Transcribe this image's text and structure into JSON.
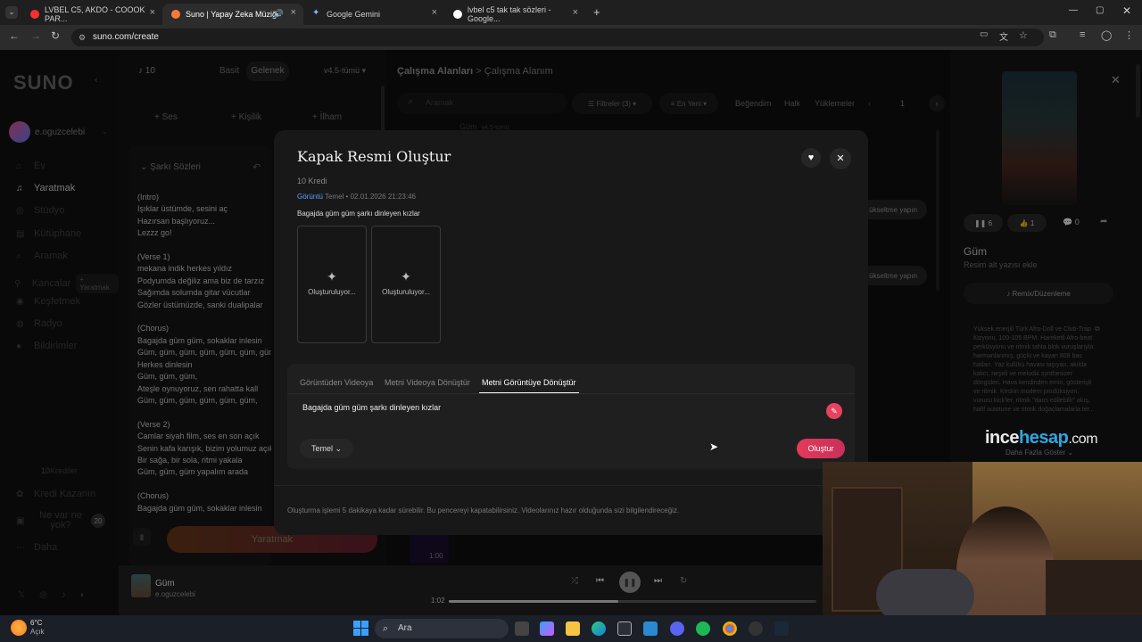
{
  "browser": {
    "tabs": [
      {
        "label": "LVBEL C5, AKDO - COOOK PAR...",
        "close": "×"
      },
      {
        "label": "Suno | Yapay Zeka Müziği",
        "close": "×"
      },
      {
        "label": "Google Gemini",
        "close": "×"
      },
      {
        "label": "lvbel c5 tak tak sözleri - Google...",
        "close": "×"
      }
    ],
    "new_tab": "+",
    "url": "suno.com/create"
  },
  "sidebar": {
    "logo": "SUNO",
    "user": "e.oguzcelebi",
    "items": [
      {
        "label": "Ev",
        "icon": "home-icon"
      },
      {
        "label": "Yaratmak",
        "icon": "music-icon"
      },
      {
        "label": "Stüdyo",
        "icon": "studio-icon"
      },
      {
        "label": "Kütüphane",
        "icon": "library-icon"
      },
      {
        "label": "Aramak",
        "icon": "search-icon"
      },
      {
        "label": "Kancalar",
        "icon": "hook-icon"
      },
      {
        "label": "Keşfetmek",
        "icon": "compass-icon"
      },
      {
        "label": "Radyo",
        "icon": "radio-icon"
      },
      {
        "label": "Bildirimler",
        "icon": "bell-icon"
      }
    ],
    "hooks_badge": "+ Yaratmak",
    "credits_num": "10",
    "credits_label": "Krediler",
    "earn": "Kredi Kazanın",
    "whats_new": "Ne var ne yok?",
    "whats_new_badge": "20",
    "more": "Daha"
  },
  "creator": {
    "credits": "10",
    "mode_simple": "Basit",
    "mode_custom": "Gelenek",
    "version": "v4.5-tümü",
    "add_audio": "+ Ses",
    "add_persona": "+ Kişilik",
    "add_inspo": "+ İlham",
    "lyrics_title": "Şarkı Sözleri",
    "lyrics": "(Intro)\nIşıklar üstümde, sesini aç\nHazırsan başlıyoruz...\nLezzz go!\n\n(Verse 1)\nmekana indik herkes yıldız\nPodyumda değiliz ama biz de tarzız\nSağımda solumda gitar vücutlar\nGözler üstümüzde, sanki dualipalar\n\n(Chorus)\nBagajda güm güm, sokaklar inlesin\nGüm, güm, güm, güm, güm, güm, güm\nHerkes dinlesin\nGüm, güm, güm,\nAteşle oynuyoruz, sen rahatta kall\nGüm, güm, güm, güm, güm, güm,\n\n(Verse 2)\nCamlar siyah film, ses en son açık\nSenin kafa karışık, bizim yolumuz açık\nBir sağa, bir sola, ritmi yakala\nGüm, güm, güm yapalım arada\n\n(Chorus)\nBagajda güm güm, sokaklar inlesin",
    "create_button": "Yaratmak"
  },
  "workspace": {
    "breadcrumb_root": "Çalışma Alanları",
    "breadcrumb_sep": ">",
    "breadcrumb_current": "Çalışma Alanım",
    "search_placeholder": "Aramak",
    "filters": "Filtreler",
    "filters_count": "(3)",
    "sort": "En Yeni",
    "liked": "Beğendim",
    "public": "Halk",
    "uploads": "Yüklemeler",
    "page": "1",
    "upgrade_1": "ükseltme yapın",
    "upgrade_2": "ükseltme yapın",
    "row_title": "Güm",
    "row_tag": "v4.5-tümü",
    "duration": "1:00"
  },
  "modal": {
    "title": "Kapak Resmi Oluştur",
    "credits": "10 Kredi",
    "tag_image": "Görüntü",
    "meta": "Temel • 02.01.2026 21:23:46",
    "prompt_echo": "Bagajda güm güm şarkı dinleyen kızlar",
    "placeholder_1": "Oluşturuluyor...",
    "placeholder_2": "Oluşturuluyor...",
    "tabs": [
      "Görüntüden Videoya",
      "Metni Videoya Dönüştür",
      "Metni Görüntüye Dönüştür"
    ],
    "prompt_text": "Bagajda güm güm şarkı dinleyen kızlar",
    "mode": "Temel",
    "create_button": "Oluştur",
    "footer": "Oluşturma işlemi 5 dakikaya kadar sürebilir. Bu pencereyi kapatabilirsiniz. Videolarınız hazır olduğunda sizi bilgilendireceğiz."
  },
  "right_panel": {
    "pause_count": "6",
    "like_count": "1",
    "comment_count": "0",
    "song_title": "Güm",
    "subtitle": "Resim alt yazısı ekle",
    "remix": "Remix/Düzenleme",
    "description": "Yüksek enerjili Türk Afro-Drill ve Club-Trap füzyonu, 100-105 BPM. Hareketli Afro-beat perküsyonu ve ritmik tahta blok vuruşlarıyla harmanlanmış, güçlü ve kayan 808 bas hatları. Yaz kulübü havası taşıyan, akılda kalıcı, neşeli ve melodik synthesizer döngüleri. Hava kendinden emin, gösterişli ve ritmik. Keskin modern prodüksiyon, vurucu kick'ler, ritmik \"dans edilebilir\" akış, hafif autotune ve ritmik doğaçlamalarla ter...",
    "show_more": "Daha Fazla Göster"
  },
  "player": {
    "title": "Güm",
    "artist": "e.oguzcelebi",
    "current_time": "1:02",
    "progress": 0.46
  },
  "watermark": {
    "part1": "ince",
    "part2": "hesap",
    "part3": ".com"
  },
  "taskbar": {
    "weather_temp": "6°C",
    "weather_desc": "Açık",
    "search": "Ara"
  },
  "colors": {
    "accent": "#e8415e",
    "tag_blue": "#5aa0ff",
    "create_gradient_start": "#ff6a2a",
    "create_gradient_end": "#e33a5a"
  }
}
